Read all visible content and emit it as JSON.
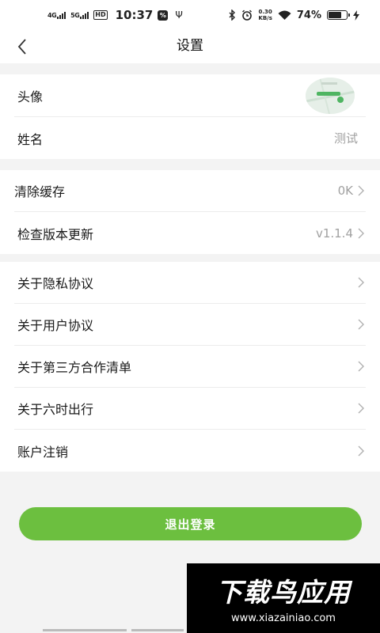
{
  "status_bar": {
    "net1": "4G",
    "net2": "5G",
    "hd": "HD",
    "time": "10:37",
    "speed_value": "0.30",
    "speed_unit": "KB/s",
    "battery_pct": "74%",
    "battery_level": 0.74
  },
  "nav": {
    "title": "设置"
  },
  "profile": {
    "avatar_label": "头像",
    "name_label": "姓名",
    "name_value": "测试"
  },
  "system": {
    "cache_label": "清除缓存",
    "cache_value": "0K",
    "update_label": "检查版本更新",
    "update_value": "v1.1.4"
  },
  "about": {
    "items": [
      {
        "label": "关于隐私协议"
      },
      {
        "label": "关于用户协议"
      },
      {
        "label": "关于第三方合作清单"
      },
      {
        "label": "关于六时出行"
      },
      {
        "label": "账户注销"
      }
    ]
  },
  "logout": {
    "label": "退出登录"
  },
  "watermark": {
    "title": "下载鸟应用",
    "url": "www.xiazainiao.com"
  },
  "colors": {
    "accent": "#6cbf3f",
    "page_bg": "#f3f3f3",
    "muted_text": "#a0a0a0"
  }
}
